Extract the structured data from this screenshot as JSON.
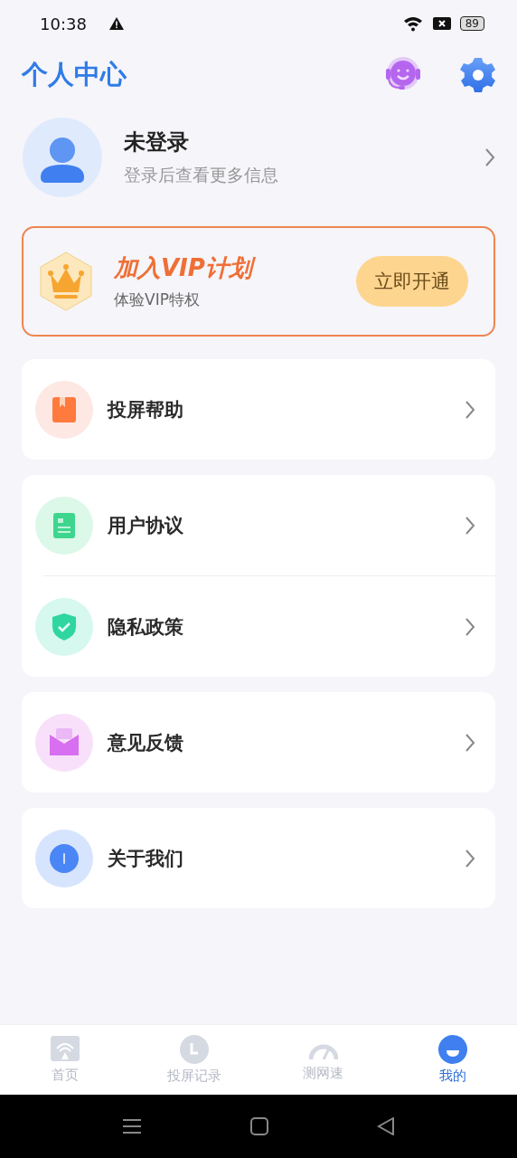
{
  "status_bar": {
    "time": "10:38",
    "battery": "89"
  },
  "header": {
    "title": "个人中心"
  },
  "profile": {
    "name": "未登录",
    "hint": "登录后查看更多信息"
  },
  "vip": {
    "title": "加入VIP计划",
    "subtitle": "体验VIP特权",
    "button": "立即开通"
  },
  "menu_groups": [
    [
      {
        "label": "投屏帮助",
        "kind": "book",
        "color": "#ff7a3d"
      }
    ],
    [
      {
        "label": "用户协议",
        "kind": "document",
        "color": "#3ed68f"
      },
      {
        "label": "隐私政策",
        "kind": "shield",
        "color": "#2fd6a0"
      }
    ],
    [
      {
        "label": "意见反馈",
        "kind": "mail",
        "color": "#d86ef0"
      }
    ],
    [
      {
        "label": "关于我们",
        "kind": "info",
        "color": "#4a86f5"
      }
    ]
  ],
  "tabs": [
    {
      "label": "首页",
      "kind": "cast",
      "selected": false
    },
    {
      "label": "投屏记录",
      "kind": "clock",
      "selected": false
    },
    {
      "label": "测网速",
      "kind": "gauge",
      "selected": false
    },
    {
      "label": "我的",
      "kind": "face",
      "selected": true
    }
  ]
}
